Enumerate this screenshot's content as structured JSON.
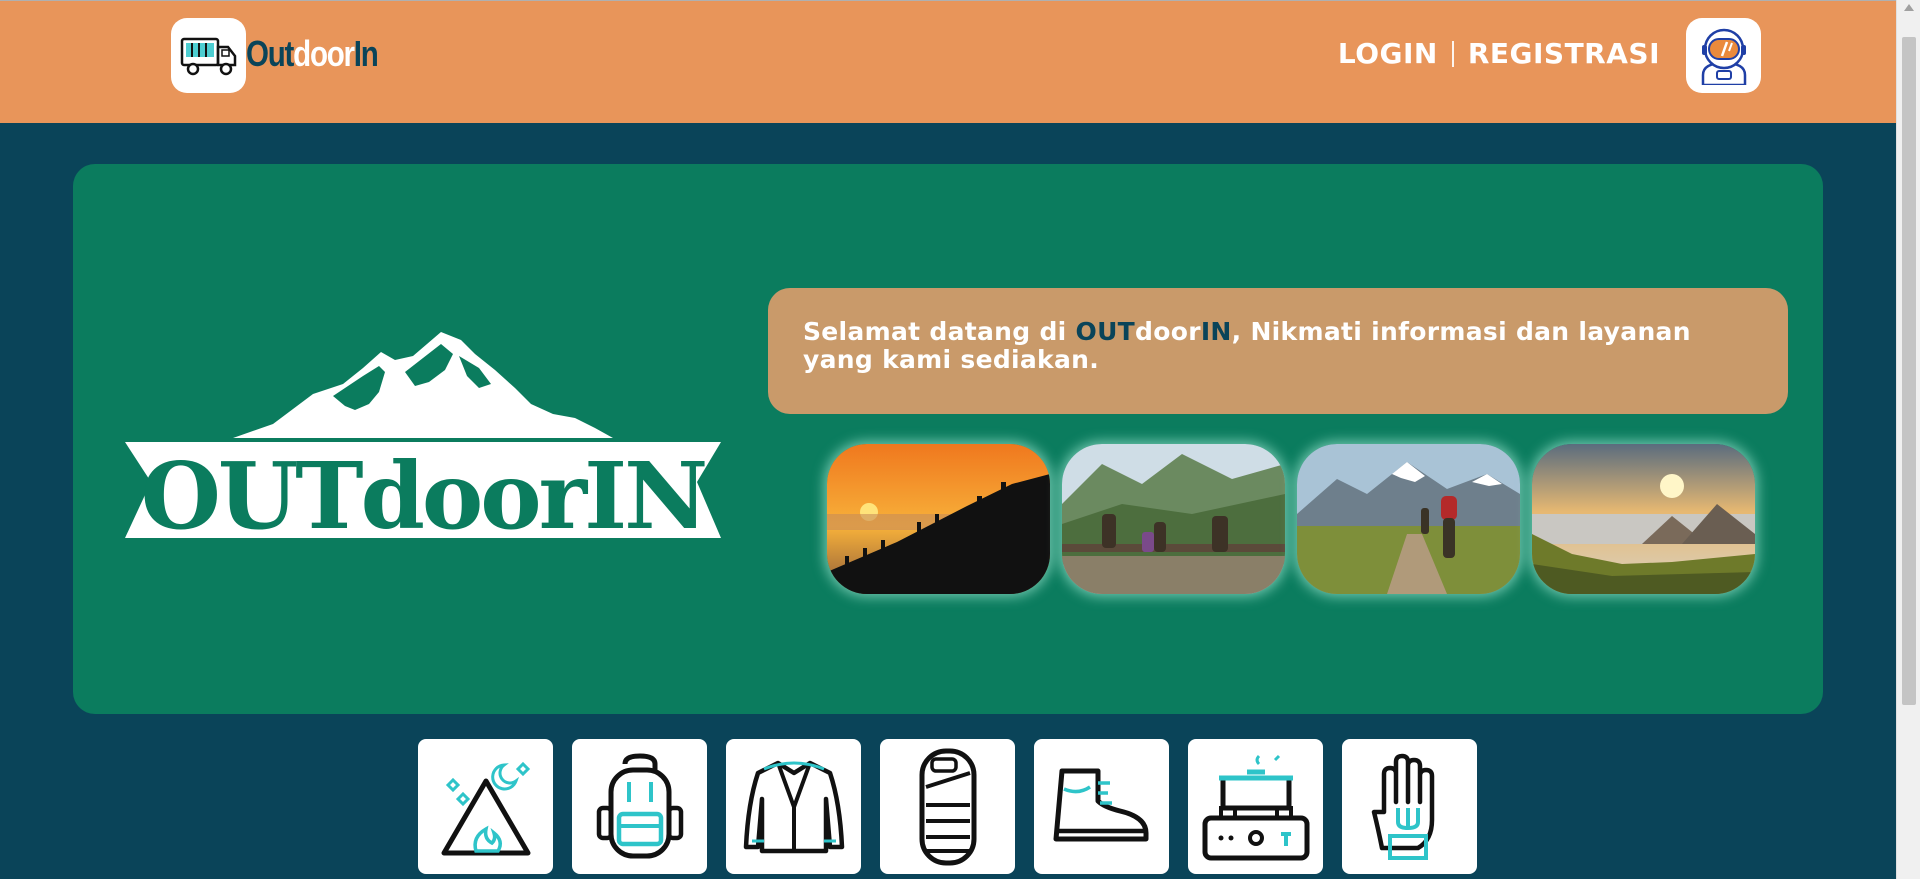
{
  "header": {
    "brand": {
      "part1": "Out",
      "part2": "door",
      "part3": "In"
    },
    "login_label": "LOGIN",
    "register_label": "REGISTRASI"
  },
  "hero": {
    "logo_text": "OUTdoorIN",
    "welcome": {
      "prefix": "Selamat datang di ",
      "brand_out": "OUT",
      "brand_door": "door",
      "brand_in": "IN",
      "suffix": ", Nikmati informasi dan layanan yang kami sediakan."
    }
  },
  "categories": [
    {
      "icon": "tent-campfire-icon"
    },
    {
      "icon": "backpack-icon"
    },
    {
      "icon": "jacket-icon"
    },
    {
      "icon": "sleeping-bag-icon"
    },
    {
      "icon": "hiking-boot-icon"
    },
    {
      "icon": "camping-stove-icon"
    },
    {
      "icon": "glove-icon"
    }
  ],
  "colors": {
    "header_bg": "#e8955a",
    "page_bg": "#0a4459",
    "hero_bg": "#0b7c5e",
    "welcome_bg": "#c99a6a",
    "accent_cyan": "#2ec4c9"
  }
}
